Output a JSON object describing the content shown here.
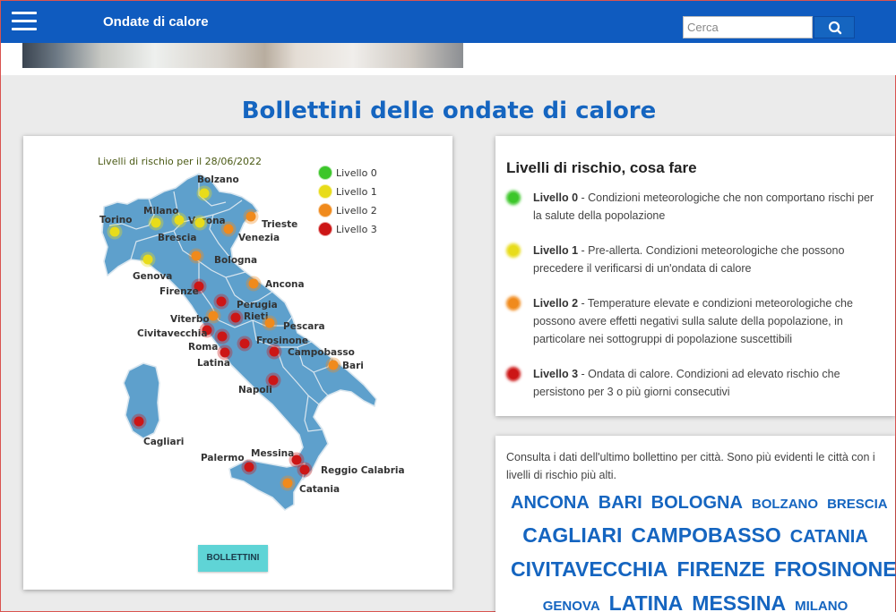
{
  "header": {
    "site_title": "Ondate di calore",
    "search_placeholder": "Cerca"
  },
  "page": {
    "title": "Bollettini delle ondate di calore"
  },
  "map": {
    "subtitle": "Livelli di rischio per il 28/06/2022",
    "legend": [
      {
        "label": "Livello 0",
        "color": "#3cc62a"
      },
      {
        "label": "Livello 1",
        "color": "#e8dc1a"
      },
      {
        "label": "Livello 2",
        "color": "#f08a1c"
      },
      {
        "label": "Livello 3",
        "color": "#cc1616"
      }
    ],
    "cities": [
      {
        "name": "Bolzano",
        "level": 1
      },
      {
        "name": "Trieste",
        "level": 2
      },
      {
        "name": "Torino",
        "level": 1
      },
      {
        "name": "Milano",
        "level": 1
      },
      {
        "name": "Verona",
        "level": 1
      },
      {
        "name": "Brescia",
        "level": 1
      },
      {
        "name": "Venezia",
        "level": 2
      },
      {
        "name": "Bologna",
        "level": 2
      },
      {
        "name": "Genova",
        "level": 1
      },
      {
        "name": "Firenze",
        "level": 3
      },
      {
        "name": "Ancona",
        "level": 2
      },
      {
        "name": "Perugia",
        "level": 3
      },
      {
        "name": "Rieti",
        "level": 3
      },
      {
        "name": "Viterbo",
        "level": 2
      },
      {
        "name": "Pescara",
        "level": 2
      },
      {
        "name": "Civitavecchia",
        "level": 3
      },
      {
        "name": "Frosinone",
        "level": 3
      },
      {
        "name": "Roma",
        "level": 3
      },
      {
        "name": "Campobasso",
        "level": 3
      },
      {
        "name": "Latina",
        "level": 3
      },
      {
        "name": "Bari",
        "level": 2
      },
      {
        "name": "Napoli",
        "level": 3
      },
      {
        "name": "Cagliari",
        "level": 3
      },
      {
        "name": "Messina",
        "level": 3
      },
      {
        "name": "Palermo",
        "level": 3
      },
      {
        "name": "Reggio Calabria",
        "level": 3
      },
      {
        "name": "Catania",
        "level": 2
      }
    ],
    "button": "BOLLETTINI"
  },
  "info": {
    "title": "Livelli di rischio, cosa fare",
    "levels": [
      {
        "name": "Livello 0",
        "text": " - Condizioni meteorologiche che non comportano rischi per la salute della popolazione",
        "color": "#3cc62a"
      },
      {
        "name": "Livello 1",
        "text": " - Pre-allerta. Condizioni meteorologiche che possono precedere il verificarsi di un'ondata di calore",
        "color": "#e8dc1a"
      },
      {
        "name": "Livello 2",
        "text": " - Temperature elevate e condizioni meteorologiche che possono avere effetti negativi sulla salute della popolazione, in particolare nei sottogruppi di popolazione suscettibili",
        "color": "#f08a1c"
      },
      {
        "name": "Livello 3",
        "text": " - Ondata di calore. Condizioni ad elevato rischio che persistono per 3 o più giorni consecutivi",
        "color": "#cc1616"
      }
    ]
  },
  "cloud": {
    "intro": "Consulta i dati dell'ultimo bollettino per città. Sono più evidenti le città con i livelli di rischio più alti.",
    "rows": [
      [
        {
          "name": "ANCONA",
          "size": 2
        },
        {
          "name": "BARI",
          "size": 2
        },
        {
          "name": "BOLOGNA",
          "size": 2
        },
        {
          "name": "BOLZANO",
          "size": 1
        },
        {
          "name": "BRESCIA",
          "size": 1
        }
      ],
      [
        {
          "name": "CAGLIARI",
          "size": 3
        },
        {
          "name": "CAMPOBASSO",
          "size": 3
        },
        {
          "name": "CATANIA",
          "size": 2
        }
      ],
      [
        {
          "name": "CIVITAVECCHIA",
          "size": 3
        },
        {
          "name": "FIRENZE",
          "size": 3
        },
        {
          "name": "FROSINONE",
          "size": 3
        }
      ],
      [
        {
          "name": "GENOVA",
          "size": 1
        },
        {
          "name": "LATINA",
          "size": 3
        },
        {
          "name": "MESSINA",
          "size": 3
        },
        {
          "name": "MILANO",
          "size": 1
        }
      ]
    ]
  }
}
